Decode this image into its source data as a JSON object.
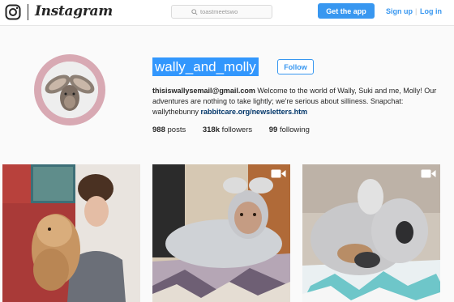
{
  "header": {
    "logo_icon": "instagram-camera-icon",
    "wordmark": "Instagram",
    "search": {
      "placeholder": "toastmeetswo",
      "icon": "search-icon"
    },
    "get_app_label": "Get the app",
    "signup_label": "Sign up",
    "separator": "|",
    "login_label": "Log in",
    "accent_color": "#3897f0"
  },
  "profile": {
    "username": "wally_and_molly",
    "follow_label": "Follow",
    "avatar_ring_color": "#d8a9b3",
    "bio": {
      "email": "thisiswallysemail@gmail.com",
      "text": " Welcome to the world of Wally, Suki and me, Molly! Our adventures are nothing to take lightly; we're serious about silliness. Snapchat: wallythebunny ",
      "link": "rabbitcare.org/newsletters.htm"
    },
    "stats": {
      "posts_count": "988",
      "posts_label": " posts",
      "followers_count": "318k",
      "followers_label": " followers",
      "following_count": "99",
      "following_label": " following"
    }
  },
  "posts": [
    {
      "type": "photo"
    },
    {
      "type": "video",
      "icon": "video-camera-icon"
    },
    {
      "type": "video",
      "icon": "video-camera-icon"
    }
  ]
}
